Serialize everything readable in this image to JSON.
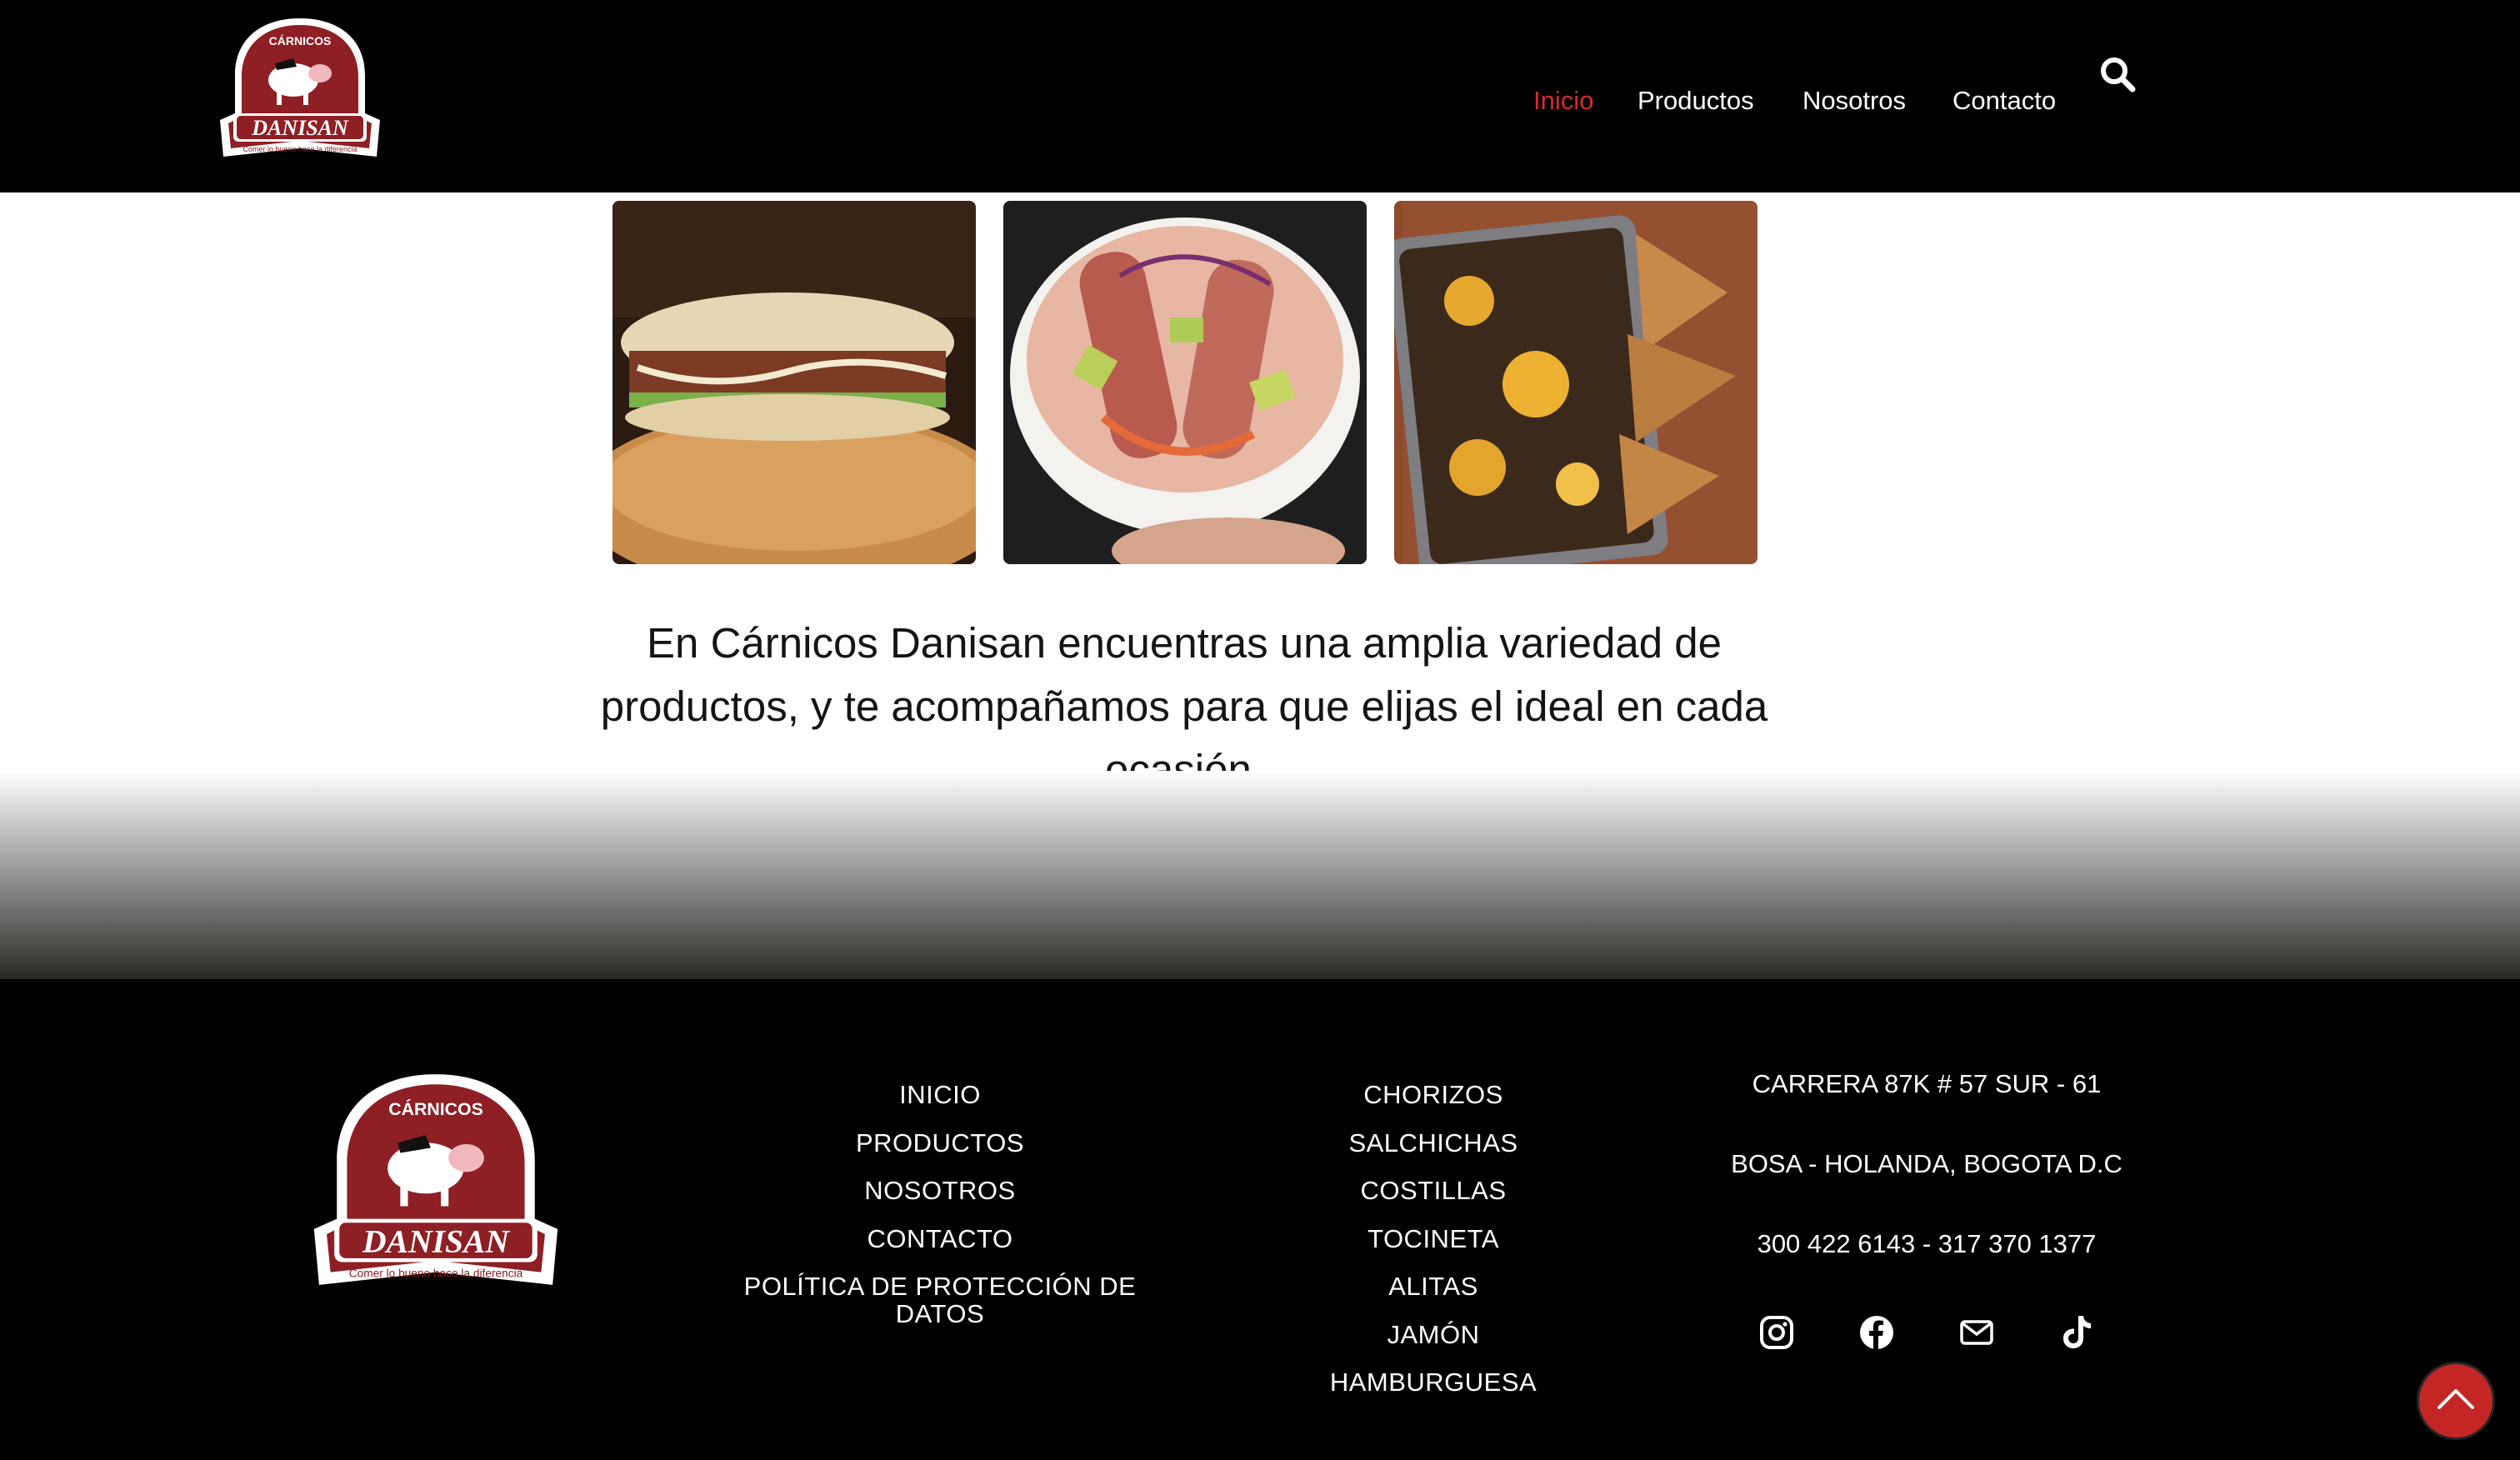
{
  "brand": {
    "logo_top_text": "CÁRNICOS",
    "logo_name": "DANISAN",
    "logo_tagline": "Comer lo bueno hace la diferencia",
    "colors": {
      "accent": "#d92a2a",
      "badge": "#8e1f24"
    }
  },
  "nav": {
    "items": [
      {
        "label": "Inicio",
        "active": true
      },
      {
        "label": "Productos"
      },
      {
        "label": "Nosotros"
      },
      {
        "label": "Contacto"
      }
    ],
    "search_icon": "search-icon"
  },
  "hero": {
    "images": [
      "sandwich-photo",
      "salchicha-bowl-photo",
      "nachos-photo"
    ],
    "text": "En Cárnicos Danisan encuentras una amplia variedad de productos, y te acompañamos para que elijas el ideal en cada ocasión."
  },
  "footer": {
    "menu": [
      "INICIO",
      "PRODUCTOS",
      "NOSOTROS",
      "CONTACTO",
      "POLÍTICA DE PROTECCIÓN DE DATOS"
    ],
    "products": [
      "CHORIZOS",
      "SALCHICHAS",
      "COSTILLAS",
      "TOCINETA",
      "ALITAS",
      "JAMÓN",
      "HAMBURGUESA"
    ],
    "address_line1": "CARRERA 87K # 57 SUR - 61",
    "address_line2": "BOSA - HOLANDA, BOGOTA D.C",
    "phones": "300 422 6143 - 317 370 1377",
    "social": [
      "instagram-icon",
      "facebook-icon",
      "mail-icon",
      "tiktok-icon"
    ]
  },
  "scroll_top_icon": "chevron-up-icon"
}
